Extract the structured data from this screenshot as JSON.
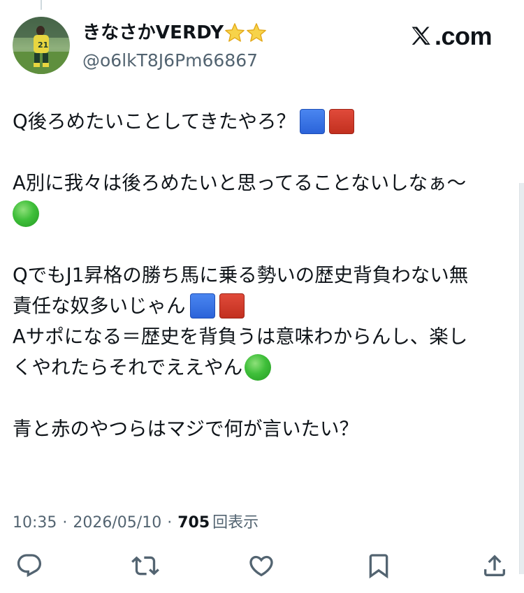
{
  "author": {
    "display_name": "きなさかVERDY",
    "badges": [
      "star-icon",
      "star-icon"
    ],
    "handle": "@o6lkT8J6Pm66867"
  },
  "watermark": {
    "text": ".com",
    "logo_icon": "x-logo-icon"
  },
  "tweet": {
    "lines": [
      {
        "text": "Q後ろめたいことしてきたやろ？",
        "emoji": [
          "blue-square",
          "red-square"
        ]
      },
      {
        "text": "",
        "emoji": []
      },
      {
        "text": "A別に我々は後ろめたいと思ってることないしなぁ〜",
        "emoji": []
      },
      {
        "text": "",
        "emoji": [
          "green-circle"
        ]
      },
      {
        "text": "",
        "emoji": []
      },
      {
        "text": "QでもJ1昇格の勝ち馬に乗る勢いの歴史背負わない無",
        "emoji": []
      },
      {
        "text": "責任な奴多いじゃん",
        "emoji": [
          "blue-square",
          "red-square"
        ]
      },
      {
        "text": "Aサポになる＝歴史を背負うは意味わからんし、楽し",
        "emoji": []
      },
      {
        "text": "くやれたらそれでええやん",
        "emoji": [
          "green-circle"
        ]
      },
      {
        "text": "",
        "emoji": []
      },
      {
        "text": "青と赤のやつらはマジで何が言いたい？",
        "emoji": []
      }
    ]
  },
  "meta": {
    "time": "10:35",
    "separator": "·",
    "date": "2026/05/10",
    "views_count": "705",
    "views_label": "回表示"
  },
  "actions": [
    {
      "name": "reply-icon"
    },
    {
      "name": "retweet-icon"
    },
    {
      "name": "like-icon"
    },
    {
      "name": "bookmark-icon"
    },
    {
      "name": "share-icon"
    }
  ],
  "colors": {
    "text": "#0f1419",
    "secondary": "#536471",
    "blue_square": "#2b63d9",
    "red_square": "#c2301f",
    "green_circle": "#3fbf3a"
  }
}
